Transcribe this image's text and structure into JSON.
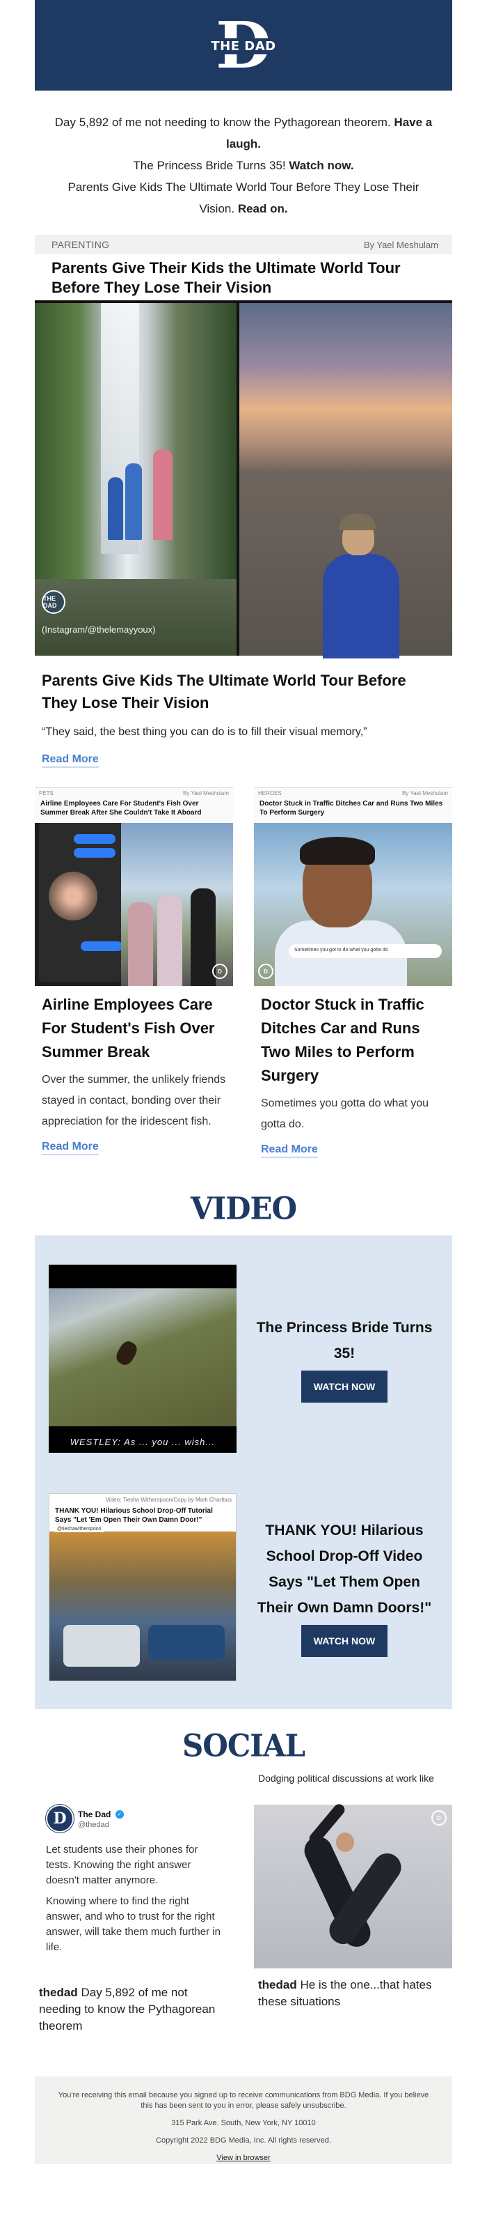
{
  "header": {
    "logo_letter": "D",
    "logo_text": "THE DAD",
    "bg_color": "#1e3a63"
  },
  "intro": {
    "line1_text": "Day 5,892 of me not needing to know the Pythagorean theorem.",
    "line1_link": "Have a laugh.",
    "line2_text": "The Princess Bride Turns 35!",
    "line2_link": "Watch now.",
    "line3_text": "Parents Give Kids The Ultimate World Tour Before They Lose Their Vision.",
    "line3_link": "Read on."
  },
  "feature": {
    "category": "PARENTING",
    "byline": "By Yael Meshulam",
    "image_headline": "Parents Give Their Kids the Ultimate World Tour Before They Lose Their Vision",
    "image_caption": "(Instagram/@thelemayyoux)",
    "image_badge": "THE DAD",
    "title": "Parents Give Kids The Ultimate World Tour Before They Lose Their Vision",
    "quote": "“They said, the best thing you can do is to fill their visual memory,”",
    "read_more": "Read More"
  },
  "stories": [
    {
      "thumb_category": "PETS",
      "thumb_byline": "By Yael Meshulam",
      "thumb_headline": "Airline Employees Care For Student's Fish Over Summer Break After She Couldn't Take It Aboard",
      "title": "Airline Employees Care For Student's Fish Over Summer Break",
      "text": "Over the summer, the unlikely friends stayed in contact, bonding over their appreciation for the iridescent fish.",
      "read_more": "Read More"
    },
    {
      "thumb_category": "HEROES",
      "thumb_byline": "By Yael Meshulam",
      "thumb_headline": "Doctor Stuck in Traffic Ditches Car and Runs Two Miles To Perform Surgery",
      "thumb_comment": "Sometimes you got to do what you gotta do",
      "title": "Doctor Stuck in Traffic Ditches Car and Runs Two Miles to Perform Surgery",
      "text": "Sometimes you gotta do what you gotta do.",
      "read_more": "Read More"
    }
  ],
  "video": {
    "section_title": "VIDEO",
    "items": [
      {
        "subtitle": "WESTLEY: As ... you ... wish...",
        "title": "The Princess Bride Turns 35!",
        "button": "WATCH NOW"
      },
      {
        "credit": "Video: Tiesha Witherspoon/Copy by Mark Charlbus",
        "thumb_headline": "THANK YOU! Hilarious School Drop-Off Tutorial Says \"Let 'Em Open Their Own Damn Door!\"",
        "thumb_tag": "@tieshawitherspoon",
        "title": "THANK YOU! Hilarious School Drop-Off Video Says \"Let Them Open Their Own Damn Doors!\"",
        "button": "WATCH NOW"
      }
    ]
  },
  "social": {
    "section_title": "SOCIAL",
    "tweet": {
      "name": "The Dad",
      "handle": "@thedad",
      "para1": "Let students use their phones for tests. Knowing the right answer doesn't matter anymore.",
      "para2": "Knowing where to find the right answer, and who to trust for the right answer, will take them much further in life.",
      "caption_handle": "thedad",
      "caption_text": "Day 5,892 of me not needing to know the Pythagorean theorem"
    },
    "instagram": {
      "headline": "Dodging political discussions at work like",
      "caption_handle": "thedad",
      "caption_text": "He is the one...that hates these situations"
    }
  },
  "footer": {
    "notice": "You're receiving this email because you signed up to receive communications from BDG Media. If you believe this has been sent to you in error, please safely unsubscribe.",
    "address": "315 Park Ave. South, New York, NY 10010",
    "copyright": "Copyright 2022 BDG Media, Inc. All rights reserved.",
    "view_link": "View in browser"
  }
}
